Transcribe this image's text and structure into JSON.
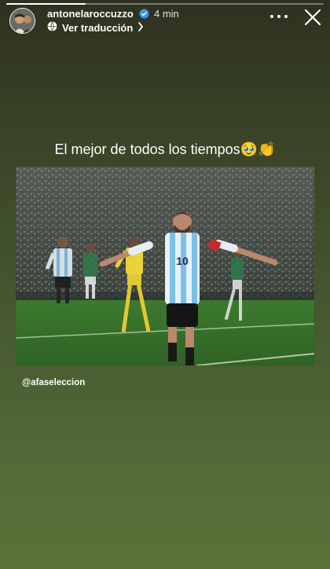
{
  "story": {
    "username": "antonelaroccuzzo",
    "time_ago": "4 min",
    "translate_label": "Ver traducción",
    "progress": 0.25,
    "caption": "El mejor de todos los tiempos🥹👏",
    "mention": "@afaseleccion",
    "player_number": "10",
    "icons": {
      "verified": "verified-badge-icon",
      "globe": "globe-icon",
      "chevron": "chevron-right-icon",
      "more": "more-options-icon",
      "close": "close-icon"
    },
    "colors": {
      "verified": "#3897f0",
      "jersey_blue": "#7cc0ea",
      "pitch": "#3f7a2e"
    }
  }
}
